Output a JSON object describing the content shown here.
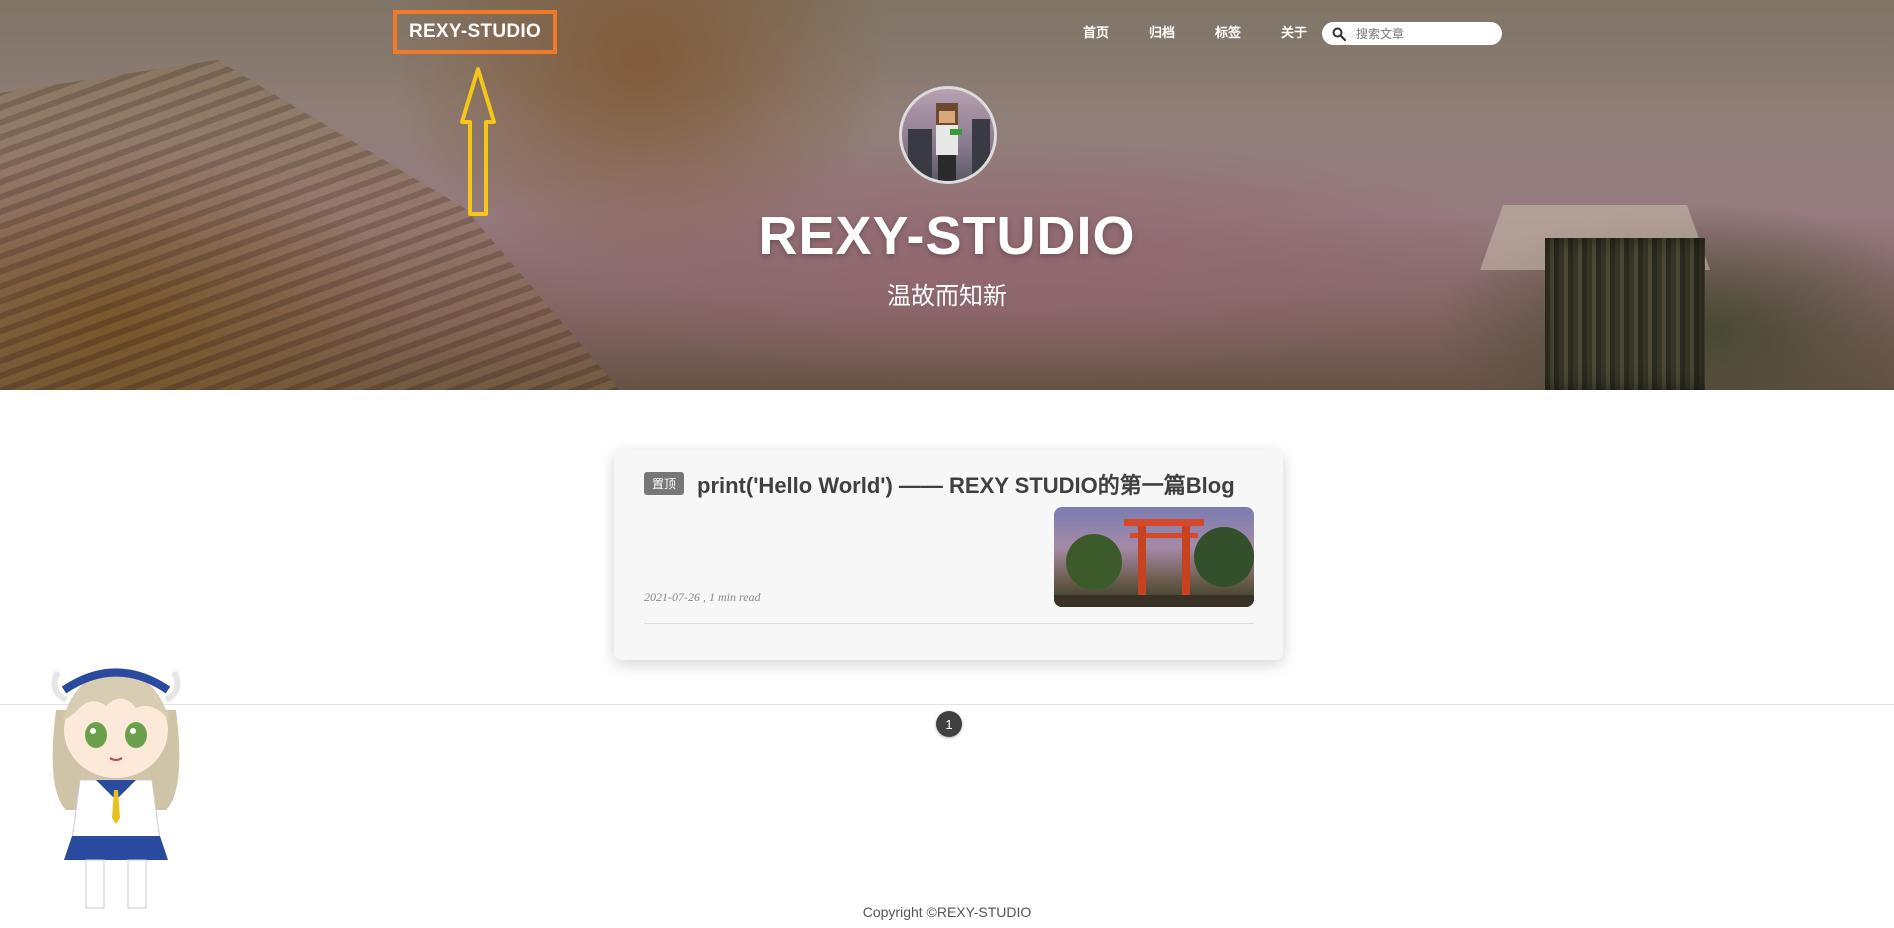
{
  "header": {
    "brand": "REXY-STUDIO",
    "nav": [
      "首页",
      "归档",
      "标签",
      "关于"
    ],
    "search_placeholder": "搜索文章"
  },
  "hero": {
    "title": "REXY-STUDIO",
    "subtitle": "温故而知新"
  },
  "post": {
    "badge": "置顶",
    "title": "print('Hello World') —— REXY STUDIO的第一篇Blog",
    "meta": "2021-07-26 , 1 min read"
  },
  "pagination": {
    "current": "1"
  },
  "footer": {
    "copyright": "Copyright ©REXY-STUDIO"
  },
  "colors": {
    "highlight_box": "#f07a2a",
    "annotation_arrow": "#f5c518",
    "pager_bg": "#404040"
  }
}
